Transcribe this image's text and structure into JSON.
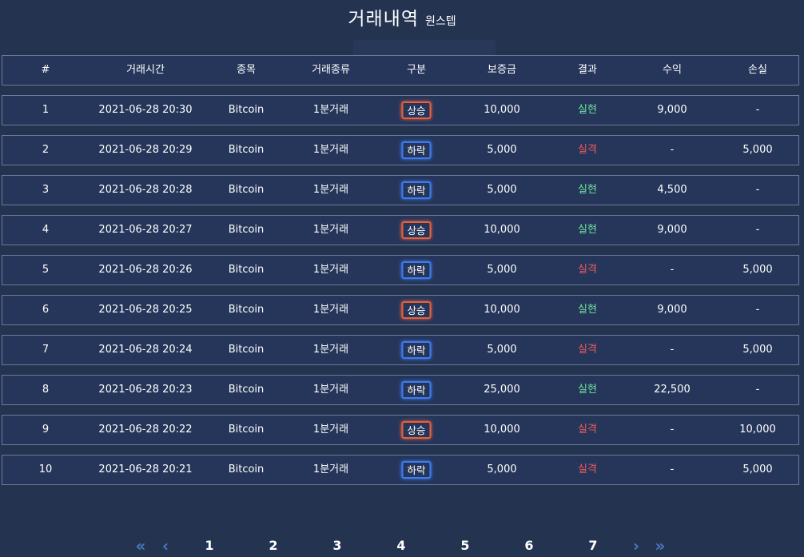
{
  "header": {
    "title": "거래내역",
    "subtitle": "원스텝"
  },
  "table": {
    "columns": [
      "#",
      "거래시간",
      "종목",
      "거래종류",
      "구분",
      "보증금",
      "결과",
      "수익",
      "손실"
    ],
    "rows": [
      {
        "no": "1",
        "time": "2021-06-28 20:30",
        "item": "Bitcoin",
        "type": "1분거래",
        "dir": "상승",
        "dir_kind": "up",
        "deposit": "10,000",
        "result": "실현",
        "result_kind": "win",
        "profit": "9,000",
        "loss": "-"
      },
      {
        "no": "2",
        "time": "2021-06-28 20:29",
        "item": "Bitcoin",
        "type": "1분거래",
        "dir": "하락",
        "dir_kind": "down",
        "deposit": "5,000",
        "result": "실격",
        "result_kind": "lose",
        "profit": "-",
        "loss": "5,000"
      },
      {
        "no": "3",
        "time": "2021-06-28 20:28",
        "item": "Bitcoin",
        "type": "1분거래",
        "dir": "하락",
        "dir_kind": "down",
        "deposit": "5,000",
        "result": "실현",
        "result_kind": "win",
        "profit": "4,500",
        "loss": "-"
      },
      {
        "no": "4",
        "time": "2021-06-28 20:27",
        "item": "Bitcoin",
        "type": "1분거래",
        "dir": "상승",
        "dir_kind": "up",
        "deposit": "10,000",
        "result": "실현",
        "result_kind": "win",
        "profit": "9,000",
        "loss": "-"
      },
      {
        "no": "5",
        "time": "2021-06-28 20:26",
        "item": "Bitcoin",
        "type": "1분거래",
        "dir": "하락",
        "dir_kind": "down",
        "deposit": "5,000",
        "result": "실격",
        "result_kind": "lose",
        "profit": "-",
        "loss": "5,000"
      },
      {
        "no": "6",
        "time": "2021-06-28 20:25",
        "item": "Bitcoin",
        "type": "1분거래",
        "dir": "상승",
        "dir_kind": "up",
        "deposit": "10,000",
        "result": "실현",
        "result_kind": "win",
        "profit": "9,000",
        "loss": "-"
      },
      {
        "no": "7",
        "time": "2021-06-28 20:24",
        "item": "Bitcoin",
        "type": "1분거래",
        "dir": "하락",
        "dir_kind": "down",
        "deposit": "5,000",
        "result": "실격",
        "result_kind": "lose",
        "profit": "-",
        "loss": "5,000"
      },
      {
        "no": "8",
        "time": "2021-06-28 20:23",
        "item": "Bitcoin",
        "type": "1분거래",
        "dir": "하락",
        "dir_kind": "down",
        "deposit": "25,000",
        "result": "실현",
        "result_kind": "win",
        "profit": "22,500",
        "loss": "-"
      },
      {
        "no": "9",
        "time": "2021-06-28 20:22",
        "item": "Bitcoin",
        "type": "1분거래",
        "dir": "상승",
        "dir_kind": "up",
        "deposit": "10,000",
        "result": "실격",
        "result_kind": "lose",
        "profit": "-",
        "loss": "10,000"
      },
      {
        "no": "10",
        "time": "2021-06-28 20:21",
        "item": "Bitcoin",
        "type": "1분거래",
        "dir": "하락",
        "dir_kind": "down",
        "deposit": "5,000",
        "result": "실격",
        "result_kind": "lose",
        "profit": "-",
        "loss": "5,000"
      }
    ]
  },
  "pagination": {
    "first": "«",
    "prev": "‹",
    "pages": [
      "1",
      "2",
      "3",
      "4",
      "5",
      "6",
      "7"
    ],
    "next": "›",
    "last": "»"
  },
  "colors": {
    "background": "#243350",
    "row_border": "#6a7a99",
    "up_badge": "#e8603c",
    "down_badge": "#3d7cf0",
    "win": "#6fe29e",
    "lose": "#f05a5a",
    "pager_arrow": "#4a78c4"
  }
}
